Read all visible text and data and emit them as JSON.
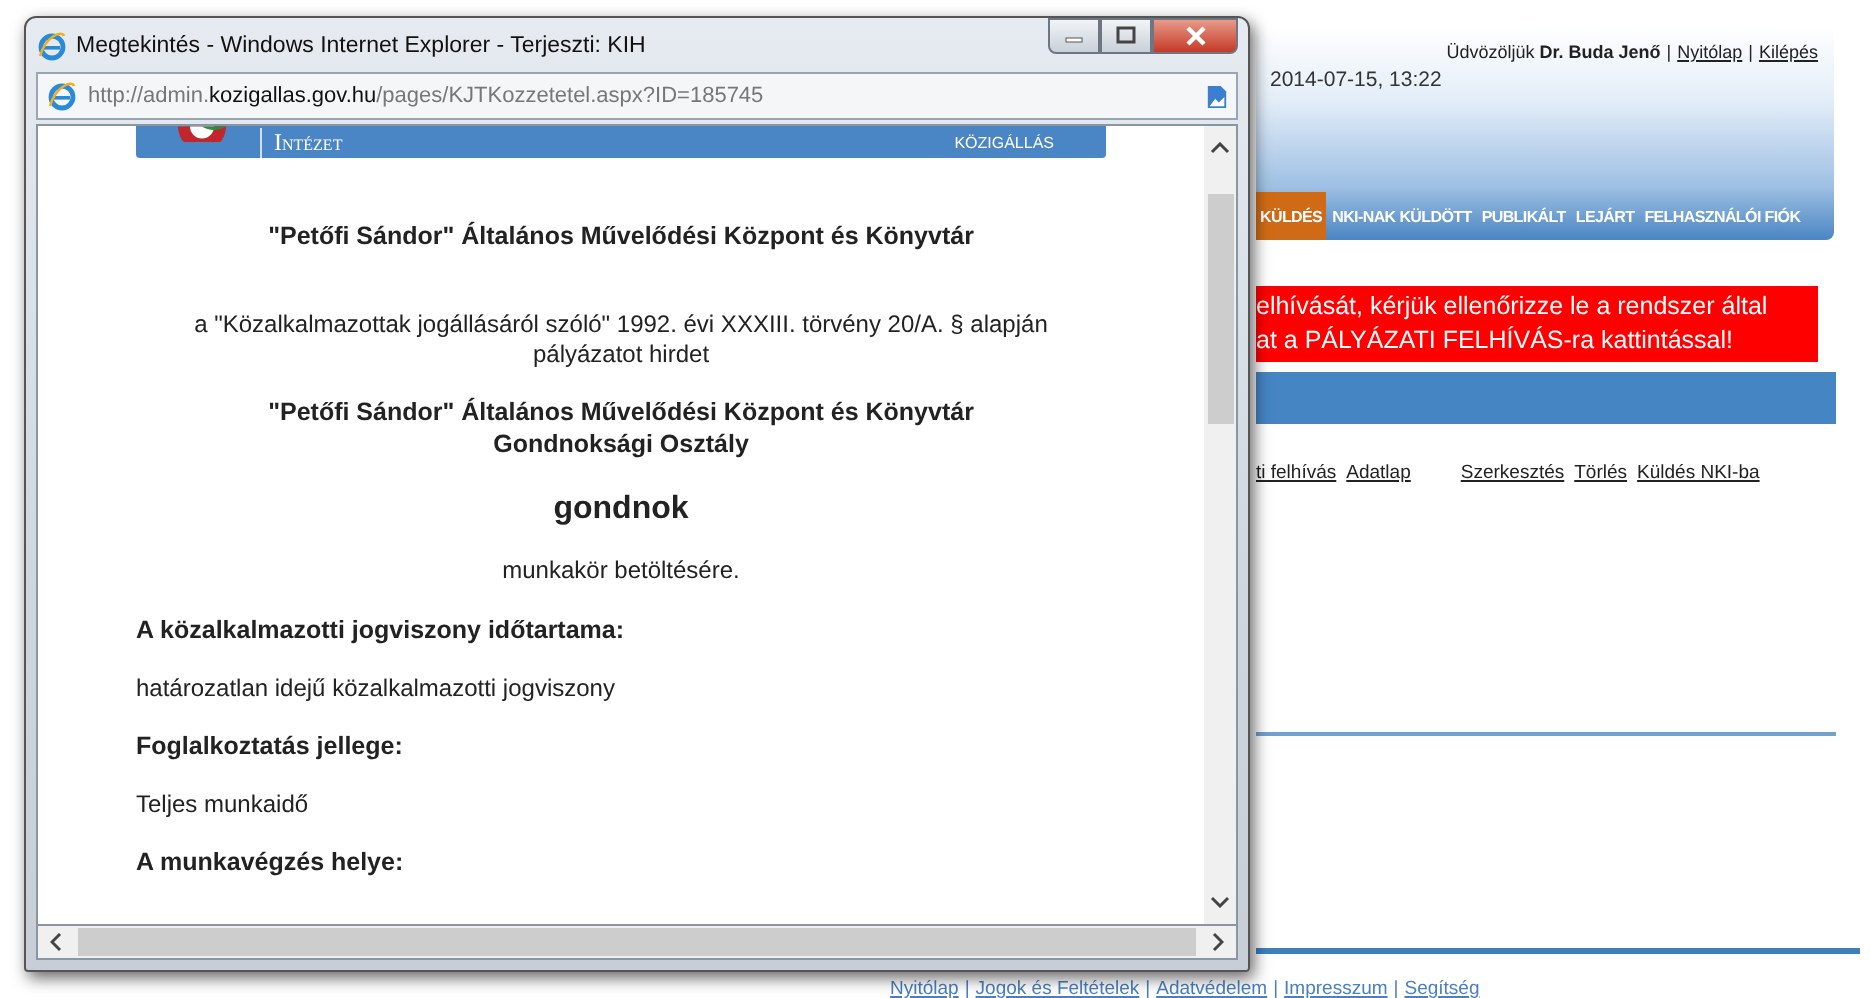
{
  "page": {
    "header": {
      "welcome": "Üdvözöljük **Dr. Buda Jenő**",
      "separator": "|",
      "links": [
        "Nyitólap",
        "Kilépés"
      ],
      "datetime": "2014-07-15, 13:22"
    },
    "nav": [
      {
        "label": "KÜLDÉS",
        "selected": true
      },
      {
        "label": "NKI-NAK KÜLDÖTT",
        "selected": false
      },
      {
        "label": "PUBLIKÁLT",
        "selected": false
      },
      {
        "label": "LEJÁRT",
        "selected": false
      },
      {
        "label": "FELHASZNÁLÓI FIÓK",
        "selected": false
      }
    ],
    "alert": [
      "elhívását, kérjük ellenőrizze le a rendszer által",
      "at a PÁLYÁZATI FELHÍVÁS-ra kattintással!"
    ],
    "row_links": [
      "ti felhívás",
      "Adatlap",
      "Szerkesztés",
      "Törlés",
      "Küldés NKI-ba"
    ],
    "footer": {
      "separator": "|",
      "links": [
        "Nyitólap",
        "Jogok és Feltételek",
        "Adatvédelem",
        "Impresszum",
        "Segítség"
      ]
    }
  },
  "popup": {
    "title": "Megtekintés - Windows Internet Explorer - Terjeszti: KIH",
    "address": {
      "prefix": "http://admin.",
      "domain": "kozigallas.gov.hu",
      "path": "/pages/KJTKozzetetel.aspx?ID=185745"
    },
    "banner": {
      "left": "Intézet",
      "right": "KÖZIGÁLLÁS"
    },
    "document": [
      {
        "kind": "heading",
        "text": "\"Petőfi Sándor\" Általános Művelődési Központ és Könyvtár"
      },
      {
        "kind": "center",
        "text": "a \"Közalkalmazottak jogállásáról szóló\" 1992. évi XXXIII. törvény 20/A. § alapján pályázatot hirdet"
      },
      {
        "kind": "heading",
        "text": "\"Petőfi Sándor\" Általános Művelődési Központ és Könyvtár Gondnoksági Osztály"
      },
      {
        "kind": "title",
        "text": "gondnok"
      },
      {
        "kind": "center",
        "text": "munkakör betöltésére."
      },
      {
        "kind": "section",
        "text": "A közalkalmazotti jogviszony időtartama:"
      },
      {
        "kind": "body",
        "text": "határozatlan idejű közalkalmazotti jogviszony"
      },
      {
        "kind": "section",
        "text": "Foglalkoztatás jellege:"
      },
      {
        "kind": "body",
        "text": "Teljes munkaidő"
      },
      {
        "kind": "section",
        "text": "A munkavégzés helye:"
      }
    ]
  }
}
